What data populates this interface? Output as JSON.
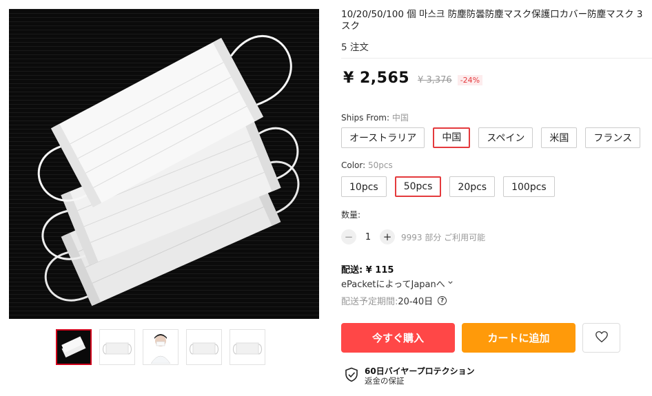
{
  "product": {
    "title": "10/20/50/100 個 마스크 防塵防曇防塵マスク保護口カバー防塵マスク 3 スク",
    "orders": "5 注文",
    "price": "¥ 2,565",
    "old_price": "¥ 3,376",
    "discount": "-24%"
  },
  "gallery": {
    "thumbnails": [
      "mask-pile-dark",
      "mask-single",
      "model-wearing-mask",
      "mask-single",
      "mask-single"
    ],
    "active_index": 0
  },
  "ships_from": {
    "label": "Ships From:",
    "selected": "中国",
    "options": [
      "オーストラリア",
      "中国",
      "スペイン",
      "米国",
      "フランス"
    ]
  },
  "color": {
    "label": "Color:",
    "selected": "50pcs",
    "options": [
      "10pcs",
      "50pcs",
      "20pcs",
      "100pcs"
    ]
  },
  "quantity": {
    "label": "数量:",
    "value": "1",
    "minus": "−",
    "plus": "+",
    "available": "9993 部分 ご利用可能"
  },
  "shipping": {
    "fee": "配送: ¥ 115",
    "method": "ePacketによってJapanへ",
    "eta_label": "配送予定期間: ",
    "eta_value": "20-40日",
    "help": "?"
  },
  "actions": {
    "buy_now": "今すぐ購入",
    "add_to_cart": "カートに追加"
  },
  "protection": {
    "title": "60日バイヤープロテクション",
    "subtitle": "返金の保証"
  },
  "colors": {
    "accent_red": "#ff4747",
    "accent_orange": "#ff9a0a",
    "selected_border": "#e4393c"
  }
}
